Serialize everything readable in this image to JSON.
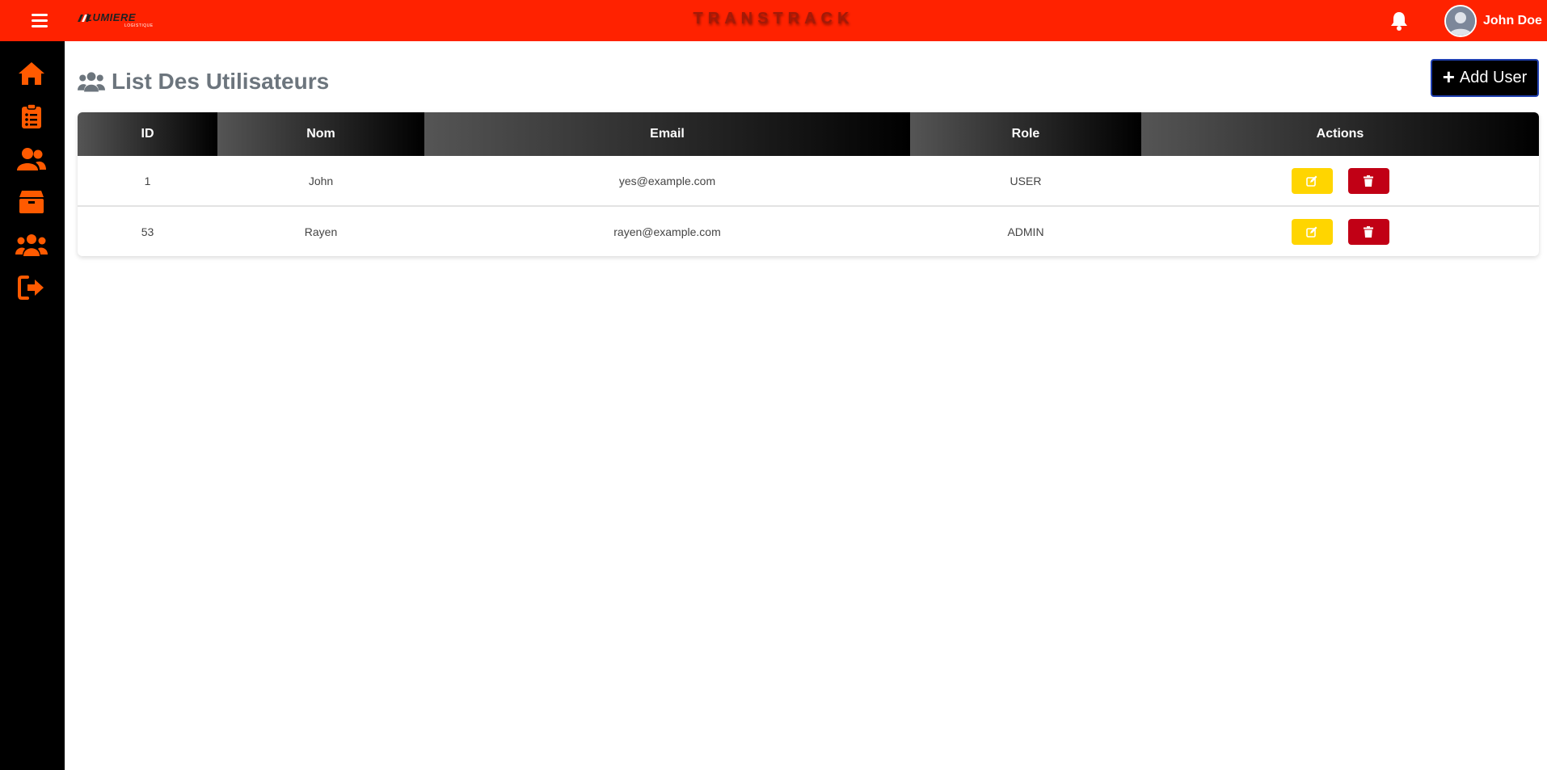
{
  "header": {
    "app_title": "TRANSTRACK",
    "logo_text": "LUMIERE",
    "logo_subtext": "LOGISTIQUE",
    "user_name": "John Doe"
  },
  "sidebar": {
    "items": [
      {
        "icon": "home-icon"
      },
      {
        "icon": "clipboard-list-icon"
      },
      {
        "icon": "users-icon"
      },
      {
        "icon": "box-icon"
      },
      {
        "icon": "users-group-icon"
      },
      {
        "icon": "logout-icon"
      }
    ]
  },
  "page": {
    "title": "List Des Utilisateurs",
    "add_button": "Add User"
  },
  "table": {
    "headers": [
      "ID",
      "Nom",
      "Email",
      "Role",
      "Actions"
    ],
    "rows": [
      {
        "id": "1",
        "nom": "John",
        "email": "yes@example.com",
        "role": "USER"
      },
      {
        "id": "53",
        "nom": "Rayen",
        "email": "rayen@example.com",
        "role": "ADMIN"
      }
    ]
  },
  "colors": {
    "topbar": "#ff2200",
    "sidebar": "#000000",
    "accent_icon": "#ff5a00",
    "edit_button": "#ffd500",
    "delete_button": "#c10015"
  }
}
